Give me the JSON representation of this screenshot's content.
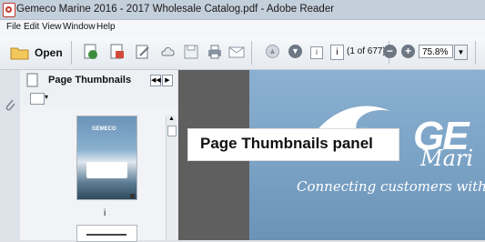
{
  "window": {
    "title": "Gemeco Marine 2016 - 2017 Wholesale Catalog.pdf - Adobe Reader"
  },
  "menu": [
    "File",
    "Edit",
    "View",
    "Window",
    "Help"
  ],
  "toolbar": {
    "open_label": "Open",
    "page_number": "i",
    "page_count": "(1 of 677)",
    "zoom": "75.8%"
  },
  "thumbnails": {
    "title": "Page Thumbnails",
    "page_label": "i",
    "thumb_brand": "GEMECO"
  },
  "document": {
    "brand": "GE",
    "brand_sub": "Mari",
    "tagline": "Connecting customers with t"
  },
  "callout": {
    "text": "Page Thumbnails panel"
  },
  "colors": {
    "doc_bg": "#7aa2c5",
    "viewer_bg": "#5f5f5f",
    "accent": "#c0392b"
  }
}
